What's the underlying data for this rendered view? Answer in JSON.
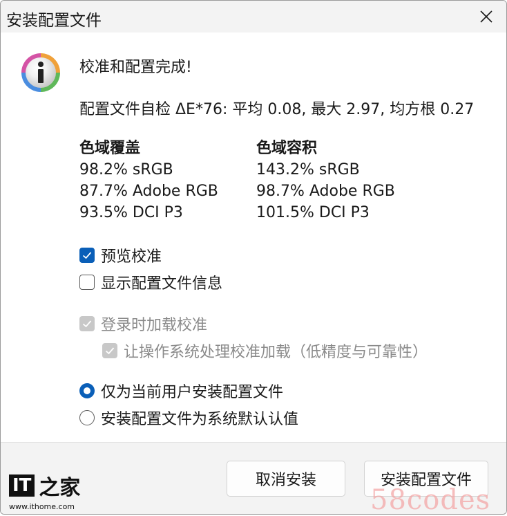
{
  "window": {
    "title": "安装配置文件"
  },
  "message": {
    "heading": "校准和配置完成!",
    "stats": "配置文件自检 ΔE*76: 平均 0.08, 最大 2.97, 均方根 0.27"
  },
  "coverage": {
    "title": "色域覆盖",
    "items": [
      "98.2% sRGB",
      "87.7% Adobe RGB",
      "93.5% DCI P3"
    ]
  },
  "volume": {
    "title": "色域容积",
    "items": [
      "143.2% sRGB",
      "98.7% Adobe RGB",
      "101.5% DCI P3"
    ]
  },
  "options": {
    "preview": {
      "label": "预览校准",
      "checked": true
    },
    "show_info": {
      "label": "显示配置文件信息",
      "checked": false
    },
    "load_on_login": {
      "label": "登录时加载校准",
      "checked": true,
      "disabled": true
    },
    "os_handle": {
      "label": "让操作系统处理校准加载（低精度与可靠性）",
      "checked": true,
      "disabled": true
    }
  },
  "install_scope": {
    "current_user": {
      "label": "仅为当前用户安装配置文件",
      "selected": true
    },
    "system_default": {
      "label": "安装配置文件为系统默认认值",
      "selected": false
    }
  },
  "buttons": {
    "cancel": "取消安装",
    "install": "安装配置文件"
  },
  "branding": {
    "logo_text": "IT之家",
    "logo_it": "IT",
    "logo_zh": "之家",
    "logo_url": "www.ithome.com",
    "watermark": "58codes"
  },
  "colors": {
    "accent": "#0a5fb8",
    "disabled": "#c8c8c8",
    "footer": "#f3f3f3"
  }
}
